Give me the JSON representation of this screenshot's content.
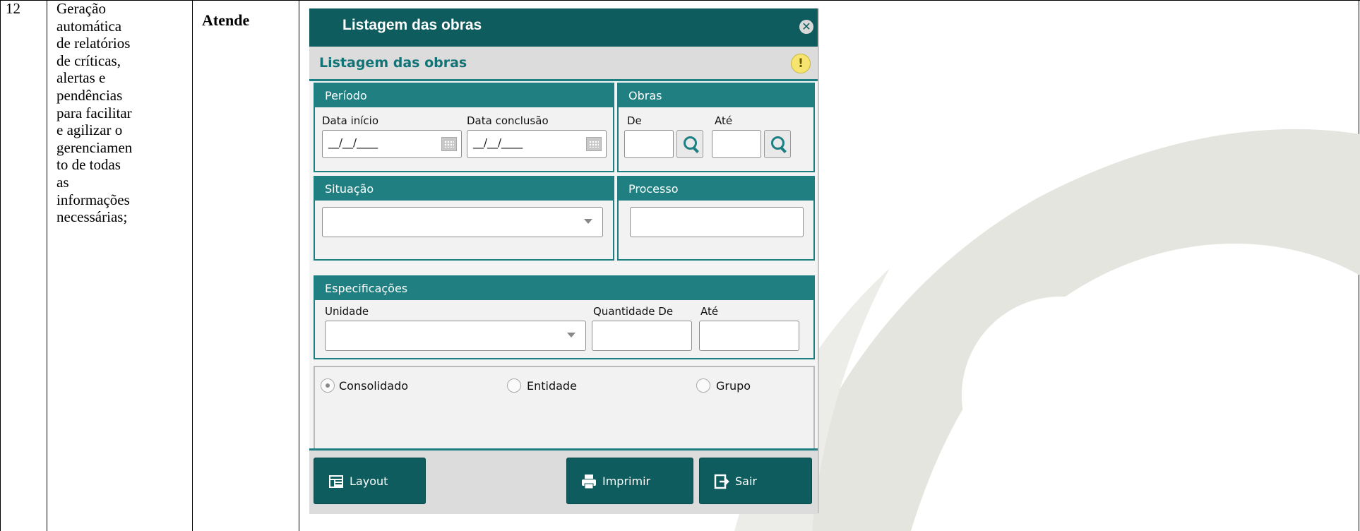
{
  "table": {
    "row_number": "12",
    "description": "Geração\nautomática\nde relatórios\nde críticas,\nalertas e\npendências\npara facilitar\ne agilizar o\ngerenciamen\nto de todas\nas\ninformações\nnecessárias;",
    "status": "Atende"
  },
  "dialog": {
    "title": "Listagem das obras",
    "subtitle": "Listagem das obras",
    "periodo": {
      "heading": "Período",
      "start_label": "Data início",
      "start_value": "__/__/____",
      "end_label": "Data conclusão",
      "end_value": "__/__/____"
    },
    "obras": {
      "heading": "Obras",
      "from_label": "De",
      "to_label": "Até",
      "from_value": "",
      "to_value": ""
    },
    "situacao": {
      "heading": "Situação",
      "value": ""
    },
    "processo": {
      "heading": "Processo",
      "value": ""
    },
    "especificacoes": {
      "heading": "Especificações",
      "unit_label": "Unidade",
      "unit_value": "",
      "qty_from_label": "Quantidade De",
      "qty_to_label": "Até",
      "qty_from_value": "",
      "qty_to_value": ""
    },
    "options": {
      "consolidado": "Consolidado",
      "entidade": "Entidade",
      "grupo": "Grupo",
      "selected": "Consolidado"
    },
    "buttons": {
      "layout": "Layout",
      "imprimir": "Imprimir",
      "sair": "Sair"
    }
  },
  "colors": {
    "title_bar": "#0f5c5e",
    "group_header": "#1f7f81",
    "accent": "#1e7f82",
    "warning": "#f6e46e",
    "watermark": "#e3e3de"
  },
  "icons": [
    "close-icon",
    "warning-icon",
    "calendar-icon",
    "search-icon",
    "dropdown-arrow-icon",
    "layout-icon",
    "printer-icon",
    "exit-icon"
  ]
}
